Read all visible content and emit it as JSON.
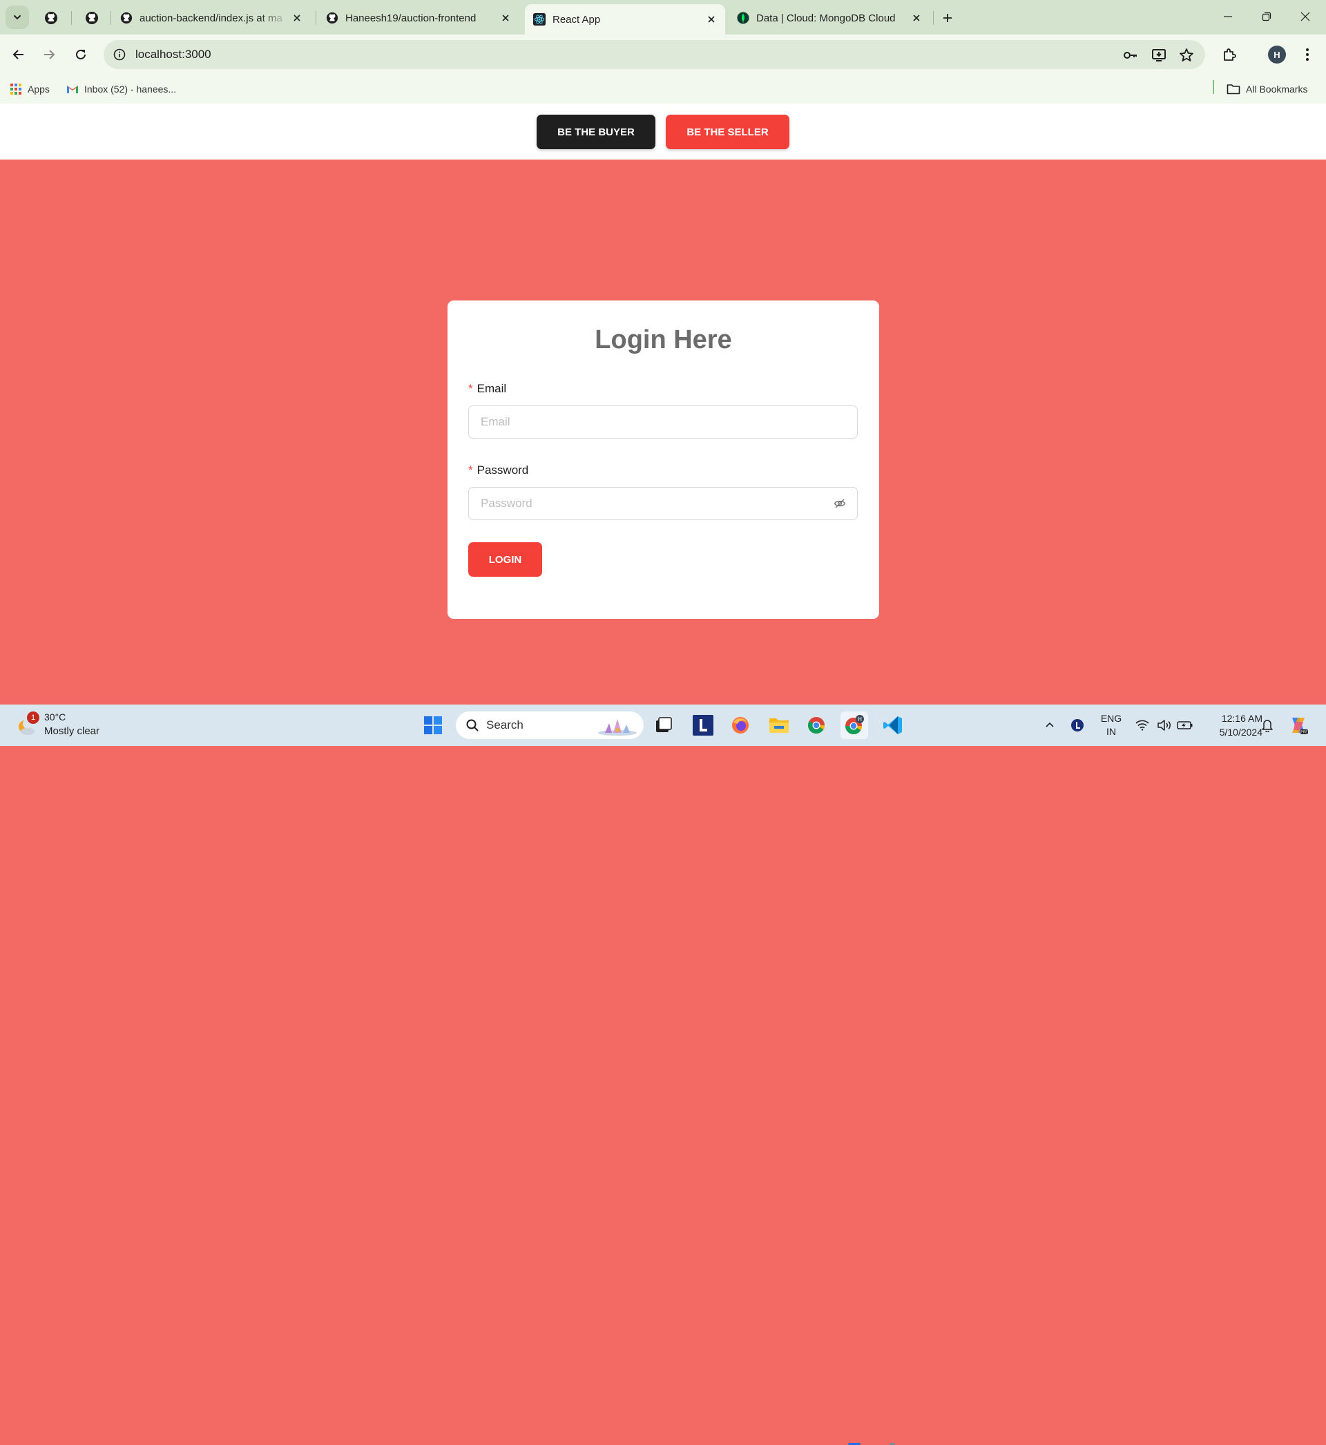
{
  "browser": {
    "tabs": [
      {
        "title": "auction-backend/index.js at ma",
        "icon": "github-icon"
      },
      {
        "title": "Haneesh19/auction-frontend",
        "icon": "github-icon"
      },
      {
        "title": "React App",
        "icon": "react-icon",
        "active": true
      },
      {
        "title": "Data | Cloud: MongoDB Cloud",
        "icon": "mongodb-leaf-icon"
      }
    ],
    "url": "localhost:3000",
    "bookmarks": [
      {
        "label": "Apps",
        "icon": "apps-grid-icon"
      },
      {
        "label": "Inbox (52) - hanees...",
        "icon": "gmail-icon"
      }
    ],
    "all_bookmarks_label": "All Bookmarks",
    "profile_initial": "H"
  },
  "page": {
    "nav": {
      "buyer_label": "BE THE BUYER",
      "seller_label": "BE THE SELLER"
    },
    "login": {
      "title": "Login Here",
      "required_mark": "*",
      "email_label": "Email",
      "email_placeholder": "Email",
      "password_label": "Password",
      "password_placeholder": "Password",
      "submit_label": "LOGIN"
    }
  },
  "taskbar": {
    "weather": {
      "temp": "30°C",
      "condition": "Mostly clear",
      "badge": "1"
    },
    "search_label": "Search",
    "tray_lang_1": "ENG",
    "tray_lang_2": "IN",
    "time": "12:16 AM",
    "date": "5/10/2024"
  },
  "colors": {
    "page_bg": "#f36a64",
    "primary": "#f3413a",
    "dark_button": "#1f1f1f",
    "browser_frame": "#d3e3cd"
  }
}
